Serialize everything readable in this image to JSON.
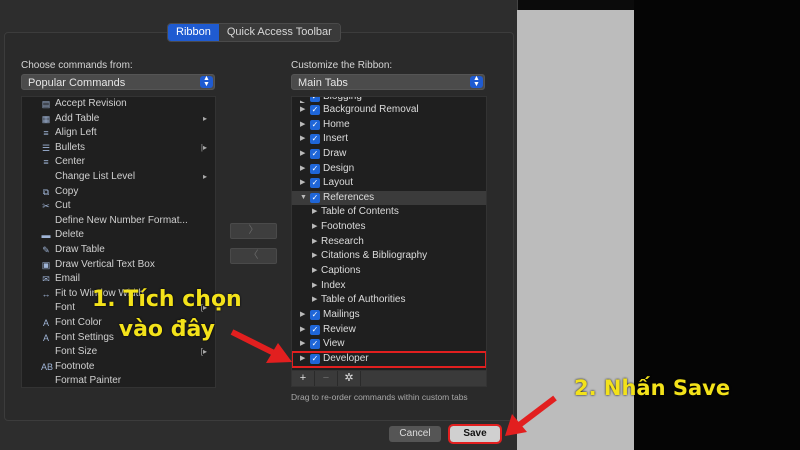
{
  "tabs": [
    "Ribbon",
    "Quick Access Toolbar"
  ],
  "left": {
    "label": "Choose commands from:",
    "selected": "Popular Commands",
    "commands": [
      {
        "label": "Accept Revision",
        "icon": "accept-revision-icon",
        "glyph": "▤",
        "sub": ""
      },
      {
        "label": "Add Table",
        "icon": "table-icon",
        "glyph": "▦",
        "sub": "▸"
      },
      {
        "label": "Align Left",
        "icon": "align-left-icon",
        "glyph": "≡",
        "sub": ""
      },
      {
        "label": "Bullets",
        "icon": "bullets-icon",
        "glyph": "☰",
        "sub": "|▸"
      },
      {
        "label": "Center",
        "icon": "align-center-icon",
        "glyph": "≡",
        "sub": ""
      },
      {
        "label": "Change List Level",
        "icon": "list-level-icon",
        "glyph": "",
        "sub": "▸"
      },
      {
        "label": "Copy",
        "icon": "copy-icon",
        "glyph": "⧉",
        "sub": ""
      },
      {
        "label": "Cut",
        "icon": "scissors-icon",
        "glyph": "✂",
        "sub": ""
      },
      {
        "label": "Define New Number Format...",
        "icon": "number-format-icon",
        "glyph": "",
        "sub": ""
      },
      {
        "label": "Delete",
        "icon": "delete-icon",
        "glyph": "▬",
        "sub": ""
      },
      {
        "label": "Draw Table",
        "icon": "draw-table-icon",
        "glyph": "✎",
        "sub": ""
      },
      {
        "label": "Draw Vertical Text Box",
        "icon": "text-box-icon",
        "glyph": "▣",
        "sub": ""
      },
      {
        "label": "Email",
        "icon": "email-icon",
        "glyph": "✉",
        "sub": ""
      },
      {
        "label": "Fit to Window Width",
        "icon": "fit-width-icon",
        "glyph": "↔",
        "sub": ""
      },
      {
        "label": "Font",
        "icon": "font-icon",
        "glyph": "",
        "sub": "[▸"
      },
      {
        "label": "Font Color",
        "icon": "font-color-icon",
        "glyph": "A",
        "sub": ""
      },
      {
        "label": "Font Settings",
        "icon": "font-settings-icon",
        "glyph": "A",
        "sub": ""
      },
      {
        "label": "Font Size",
        "icon": "font-size-icon",
        "glyph": "",
        "sub": "[▸"
      },
      {
        "label": "Footnote",
        "icon": "footnote-icon",
        "glyph": "AB",
        "sub": ""
      },
      {
        "label": "Format Painter",
        "icon": "format-painter-icon",
        "glyph": "",
        "sub": ""
      }
    ]
  },
  "move_buttons": {
    "add": "〉",
    "remove": "〈"
  },
  "right": {
    "label": "Customize the Ribbon:",
    "selected": "Main Tabs",
    "items": [
      {
        "label": "Blogging",
        "type": "tab",
        "expanded": false,
        "checked": true,
        "partial": true
      },
      {
        "label": "Background Removal",
        "type": "tab",
        "expanded": false,
        "checked": true
      },
      {
        "label": "Home",
        "type": "tab",
        "expanded": false,
        "checked": true
      },
      {
        "label": "Insert",
        "type": "tab",
        "expanded": false,
        "checked": true
      },
      {
        "label": "Draw",
        "type": "tab",
        "expanded": false,
        "checked": true
      },
      {
        "label": "Design",
        "type": "tab",
        "expanded": false,
        "checked": true
      },
      {
        "label": "Layout",
        "type": "tab",
        "expanded": false,
        "checked": true
      },
      {
        "label": "References",
        "type": "tab",
        "expanded": true,
        "checked": true,
        "selected": true
      },
      {
        "label": "Table of Contents",
        "type": "group"
      },
      {
        "label": "Footnotes",
        "type": "group"
      },
      {
        "label": "Research",
        "type": "group"
      },
      {
        "label": "Citations & Bibliography",
        "type": "group"
      },
      {
        "label": "Captions",
        "type": "group"
      },
      {
        "label": "Index",
        "type": "group"
      },
      {
        "label": "Table of Authorities",
        "type": "group"
      },
      {
        "label": "Mailings",
        "type": "tab",
        "expanded": false,
        "checked": true
      },
      {
        "label": "Review",
        "type": "tab",
        "expanded": false,
        "checked": true
      },
      {
        "label": "View",
        "type": "tab",
        "expanded": false,
        "checked": true
      },
      {
        "label": "Developer",
        "type": "tab",
        "expanded": false,
        "checked": true,
        "highlight": true
      }
    ],
    "toolbar": {
      "add": "+",
      "remove": "−",
      "settings": "✲"
    }
  },
  "hint": "Drag to re-order commands within custom tabs",
  "buttons": {
    "cancel": "Cancel",
    "save": "Save"
  },
  "annotations": {
    "step1_line1": "1. Tích chọn",
    "step1_line2": "vào đây",
    "step2": "2. Nhấn Save"
  },
  "colors": {
    "accent": "#1f5bd1",
    "annotation_text": "#f3e21a",
    "highlight_red": "#e21f1f"
  }
}
